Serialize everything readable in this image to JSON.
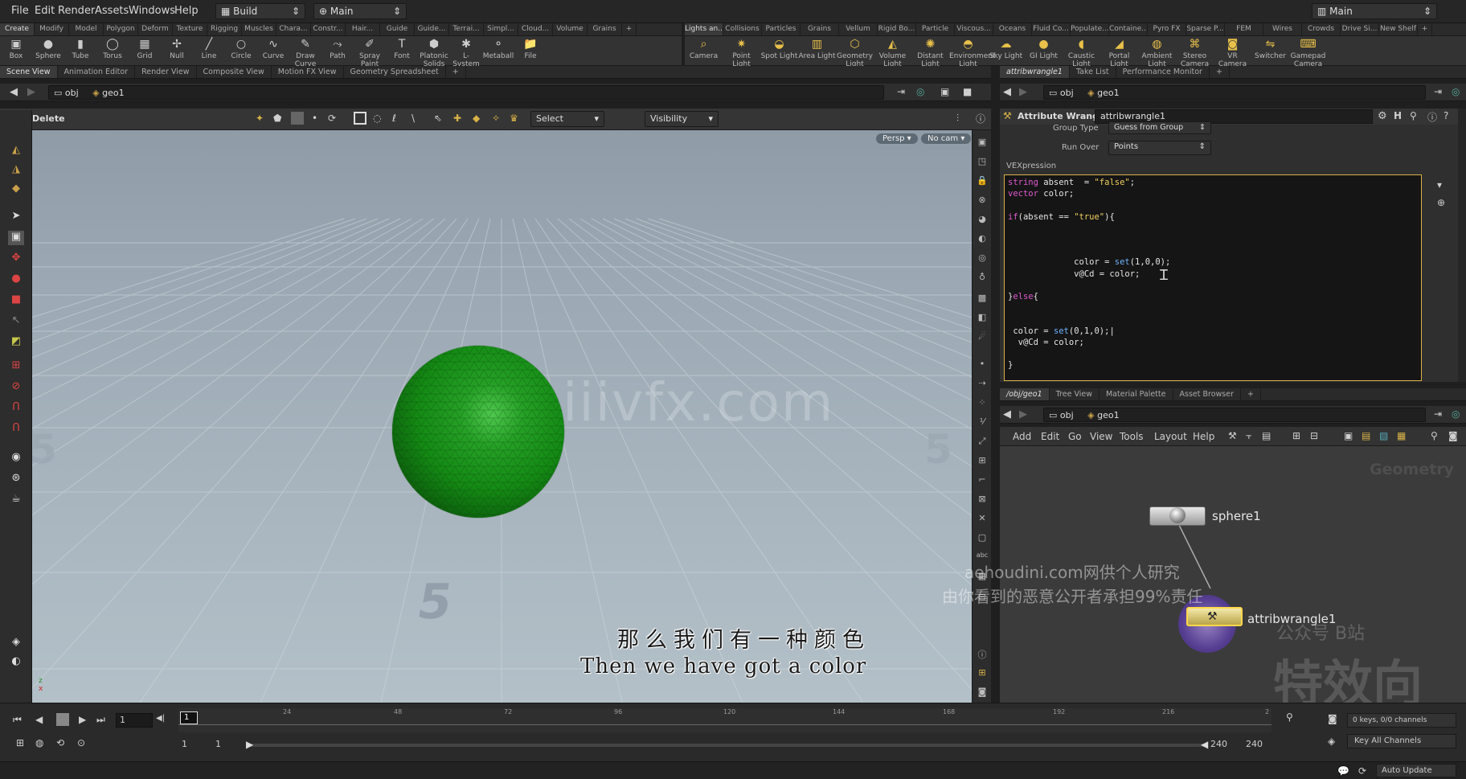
{
  "menubar": {
    "items": [
      "File",
      "Edit",
      "Render",
      "Assets",
      "Windows",
      "Help"
    ],
    "desktop": "Build",
    "context": "Main",
    "right_desktop": "Main"
  },
  "shelf_tabs_left": [
    "Create",
    "Modify",
    "Model",
    "Polygon",
    "Deform",
    "Texture",
    "Rigging",
    "Muscles",
    "Chara...",
    "Constr...",
    "Hair...",
    "Guide",
    "Guide...",
    "Terrai...",
    "Simpl...",
    "Cloud...",
    "Volume",
    "Grains"
  ],
  "shelf_tabs_right": [
    "Lights an...",
    "Collisions",
    "Particles",
    "Grains",
    "Vellum",
    "Rigid Bo...",
    "Particle",
    "Viscous...",
    "Oceans",
    "Fluid Co...",
    "Populate...",
    "Containe...",
    "Pyro FX",
    "Sparse P...",
    "FEM",
    "Wires",
    "Crowds",
    "Drive Si...",
    "New Shelf"
  ],
  "shelf_tools_left": [
    {
      "label": "Box",
      "icon": "box-icon"
    },
    {
      "label": "Sphere",
      "icon": "sphere-icon"
    },
    {
      "label": "Tube",
      "icon": "tube-icon"
    },
    {
      "label": "Torus",
      "icon": "torus-icon"
    },
    {
      "label": "Grid",
      "icon": "grid-icon"
    },
    {
      "label": "Null",
      "icon": "null-icon"
    },
    {
      "label": "Line",
      "icon": "line-icon"
    },
    {
      "label": "Circle",
      "icon": "circle-icon"
    },
    {
      "label": "Curve",
      "icon": "curve-icon"
    },
    {
      "label": "Draw Curve",
      "icon": "draw-curve-icon"
    },
    {
      "label": "Path",
      "icon": "path-icon"
    },
    {
      "label": "Spray Paint",
      "icon": "spray-paint-icon"
    },
    {
      "label": "Font",
      "icon": "font-icon"
    },
    {
      "label": "Platonic Solids",
      "icon": "platonic-icon"
    },
    {
      "label": "L-System",
      "icon": "lsystem-icon"
    },
    {
      "label": "Metaball",
      "icon": "metaball-icon"
    },
    {
      "label": "File",
      "icon": "file-icon"
    }
  ],
  "shelf_tools_right": [
    {
      "label": "Camera",
      "icon": "camera-icon"
    },
    {
      "label": "Point Light",
      "icon": "point-light-icon"
    },
    {
      "label": "Spot Light",
      "icon": "spot-light-icon"
    },
    {
      "label": "Area Light",
      "icon": "area-light-icon"
    },
    {
      "label": "Geometry Light",
      "icon": "geometry-light-icon"
    },
    {
      "label": "Volume Light",
      "icon": "volume-light-icon"
    },
    {
      "label": "Distant Light",
      "icon": "distant-light-icon"
    },
    {
      "label": "Environment Light",
      "icon": "environment-light-icon"
    },
    {
      "label": "Sky Light",
      "icon": "sky-light-icon"
    },
    {
      "label": "GI Light",
      "icon": "gi-light-icon"
    },
    {
      "label": "Caustic Light",
      "icon": "caustic-light-icon"
    },
    {
      "label": "Portal Light",
      "icon": "portal-light-icon"
    },
    {
      "label": "Ambient Light",
      "icon": "ambient-light-icon"
    },
    {
      "label": "Stereo Camera",
      "icon": "stereo-camera-icon"
    },
    {
      "label": "VR Camera",
      "icon": "vr-camera-icon"
    },
    {
      "label": "Switcher",
      "icon": "switcher-icon"
    },
    {
      "label": "Gamepad Camera",
      "icon": "gamepad-camera-icon"
    }
  ],
  "viewport_tabs": [
    "Scene View",
    "Animation Editor",
    "Render View",
    "Composite View",
    "Motion FX View",
    "Geometry Spreadsheet"
  ],
  "viewport_path": {
    "root": "obj",
    "node": "geo1"
  },
  "viewport_options": {
    "tool": "Delete",
    "select": "Select",
    "visibility": "Visibility",
    "persp": "Persp ▾",
    "cam": "No cam ▾"
  },
  "parm_tabs": [
    "attribwrangle1",
    "Take List",
    "Performance Monitor"
  ],
  "parm_path": {
    "root": "obj",
    "node": "geo1"
  },
  "parm": {
    "type": "Attribute Wrangle",
    "name": "attribwrangle1",
    "group_type_label": "Group Type",
    "group_type_value": "Guess from Group",
    "run_over_label": "Run Over",
    "run_over_value": "Points",
    "vex_label": "VEXpression"
  },
  "network_tabs": [
    "/obj/geo1",
    "Tree View",
    "Material Palette",
    "Asset Browser"
  ],
  "network_path": {
    "root": "obj",
    "node": "geo1"
  },
  "network_menu": [
    "Add",
    "Edit",
    "Go",
    "View",
    "Tools",
    "Layout",
    "Help"
  ],
  "network": {
    "context_label": "Geometry",
    "node1": "sphere1",
    "node2": "attribwrangle1"
  },
  "overlays": {
    "watermark_center": "iiivfx.com",
    "wm_line1": "aehoudini.com网供个人研究",
    "wm_line2": "由你看到的恶意公开者承担99%责任",
    "wm_line3": "公众号 B站",
    "wm_big": "特效向",
    "sub_cn": "那么我们有一种颜色",
    "sub_en": "Then we have got a color"
  },
  "timeline": {
    "frame": "1",
    "current_marker": "1",
    "ticks": [
      "24",
      "48",
      "72",
      "96",
      "120",
      "144",
      "168",
      "192",
      "216",
      "2"
    ],
    "start": "1",
    "start2": "1",
    "end": "240",
    "end2": "240",
    "keys": "0 keys, 0/0 channels",
    "key_all": "Key All Channels",
    "auto_update": "Auto Update"
  },
  "colors": {
    "sphere": "#1f8a1f",
    "accent": "#d8b248",
    "viewport_bg": "#9ba8b3"
  }
}
